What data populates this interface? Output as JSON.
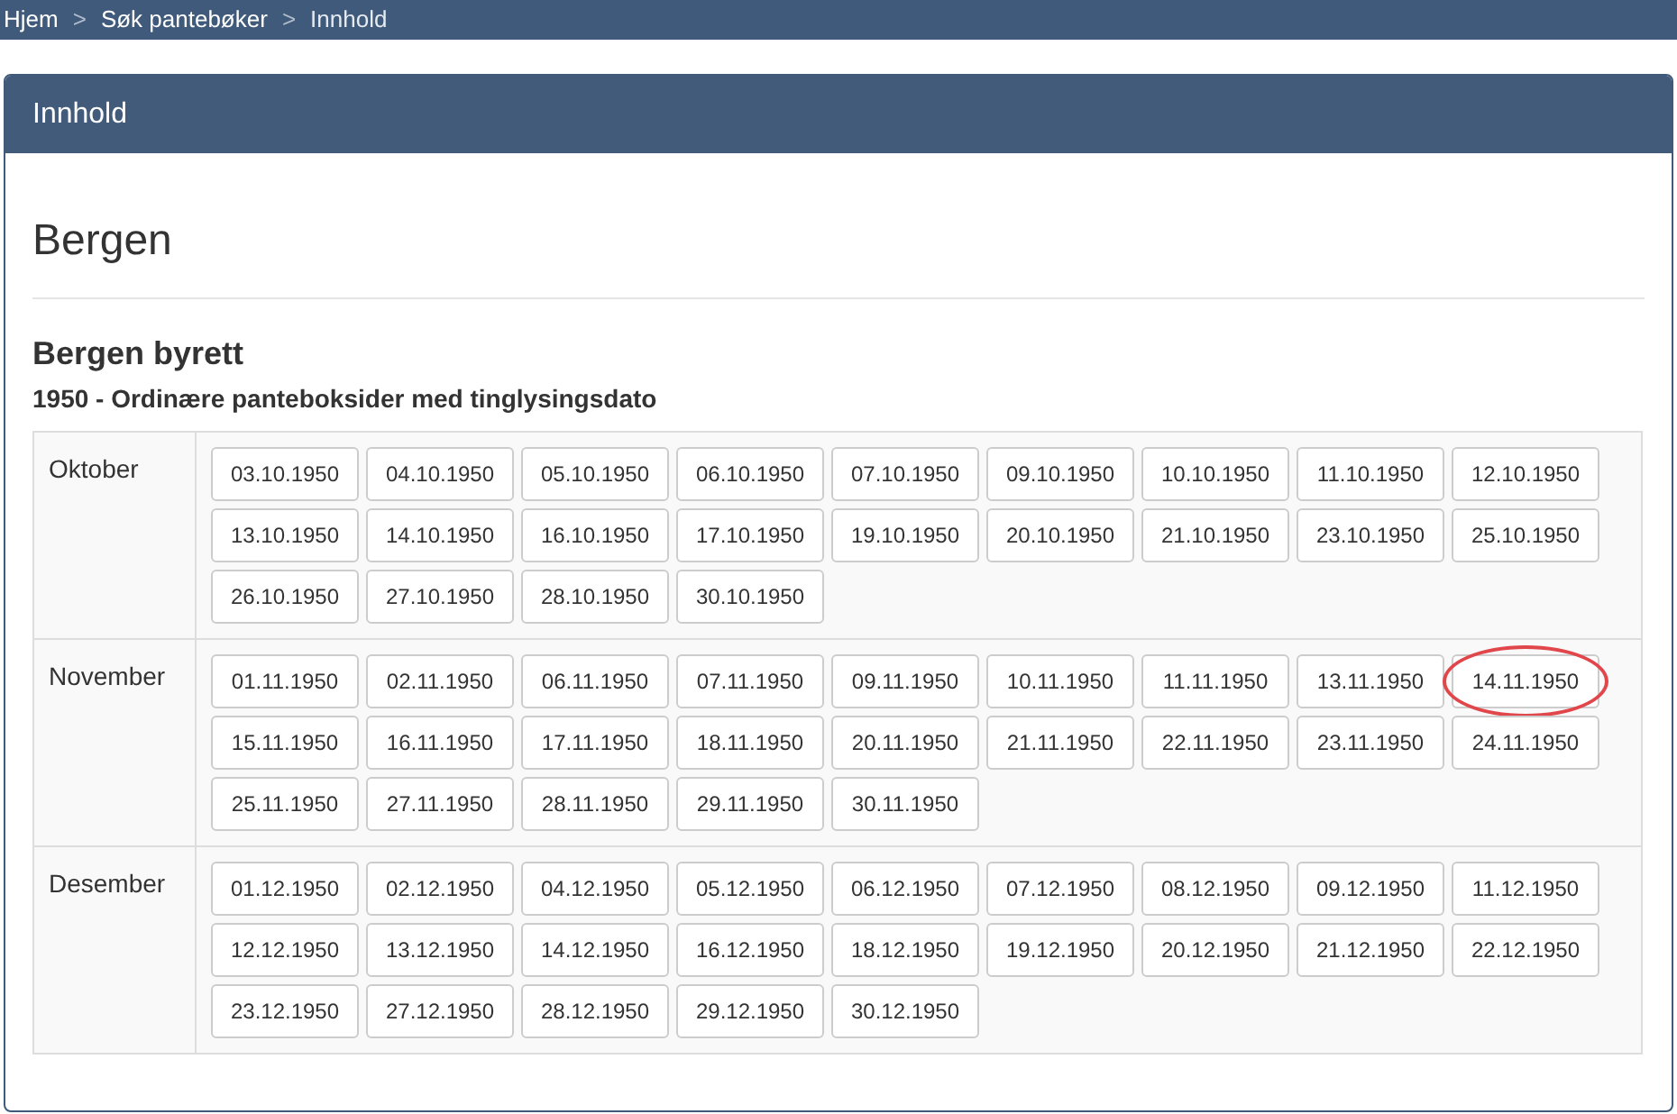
{
  "breadcrumb": [
    "Hjem",
    "Søk pantebøker",
    "Innhold"
  ],
  "breadcrumb_separator": ">",
  "panel": {
    "title": "Innhold"
  },
  "place": "Bergen",
  "court": "Bergen byrett",
  "subtitle": "1950 - Ordinære panteboksider med tinglysingsdato",
  "months": [
    {
      "name": "Oktober",
      "dates": [
        {
          "label": "03.10.1950",
          "circled": false
        },
        {
          "label": "04.10.1950",
          "circled": false
        },
        {
          "label": "05.10.1950",
          "circled": false
        },
        {
          "label": "06.10.1950",
          "circled": false
        },
        {
          "label": "07.10.1950",
          "circled": false
        },
        {
          "label": "09.10.1950",
          "circled": false
        },
        {
          "label": "10.10.1950",
          "circled": false
        },
        {
          "label": "11.10.1950",
          "circled": false
        },
        {
          "label": "12.10.1950",
          "circled": false
        },
        {
          "label": "13.10.1950",
          "circled": false
        },
        {
          "label": "14.10.1950",
          "circled": false
        },
        {
          "label": "16.10.1950",
          "circled": false
        },
        {
          "label": "17.10.1950",
          "circled": false
        },
        {
          "label": "19.10.1950",
          "circled": false
        },
        {
          "label": "20.10.1950",
          "circled": false
        },
        {
          "label": "21.10.1950",
          "circled": false
        },
        {
          "label": "23.10.1950",
          "circled": false
        },
        {
          "label": "25.10.1950",
          "circled": false
        },
        {
          "label": "26.10.1950",
          "circled": false
        },
        {
          "label": "27.10.1950",
          "circled": false
        },
        {
          "label": "28.10.1950",
          "circled": false
        },
        {
          "label": "30.10.1950",
          "circled": false
        }
      ]
    },
    {
      "name": "November",
      "dates": [
        {
          "label": "01.11.1950",
          "circled": false
        },
        {
          "label": "02.11.1950",
          "circled": false
        },
        {
          "label": "06.11.1950",
          "circled": false
        },
        {
          "label": "07.11.1950",
          "circled": false
        },
        {
          "label": "09.11.1950",
          "circled": false
        },
        {
          "label": "10.11.1950",
          "circled": false
        },
        {
          "label": "11.11.1950",
          "circled": false
        },
        {
          "label": "13.11.1950",
          "circled": false
        },
        {
          "label": "14.11.1950",
          "circled": true
        },
        {
          "label": "15.11.1950",
          "circled": false
        },
        {
          "label": "16.11.1950",
          "circled": false
        },
        {
          "label": "17.11.1950",
          "circled": false
        },
        {
          "label": "18.11.1950",
          "circled": false
        },
        {
          "label": "20.11.1950",
          "circled": false
        },
        {
          "label": "21.11.1950",
          "circled": false
        },
        {
          "label": "22.11.1950",
          "circled": false
        },
        {
          "label": "23.11.1950",
          "circled": false
        },
        {
          "label": "24.11.1950",
          "circled": false
        },
        {
          "label": "25.11.1950",
          "circled": false
        },
        {
          "label": "27.11.1950",
          "circled": false
        },
        {
          "label": "28.11.1950",
          "circled": false
        },
        {
          "label": "29.11.1950",
          "circled": false
        },
        {
          "label": "30.11.1950",
          "circled": false
        }
      ]
    },
    {
      "name": "Desember",
      "dates": [
        {
          "label": "01.12.1950",
          "circled": false
        },
        {
          "label": "02.12.1950",
          "circled": false
        },
        {
          "label": "04.12.1950",
          "circled": false
        },
        {
          "label": "05.12.1950",
          "circled": false
        },
        {
          "label": "06.12.1950",
          "circled": false
        },
        {
          "label": "07.12.1950",
          "circled": false
        },
        {
          "label": "08.12.1950",
          "circled": false
        },
        {
          "label": "09.12.1950",
          "circled": false
        },
        {
          "label": "11.12.1950",
          "circled": false
        },
        {
          "label": "12.12.1950",
          "circled": false
        },
        {
          "label": "13.12.1950",
          "circled": false
        },
        {
          "label": "14.12.1950",
          "circled": false
        },
        {
          "label": "16.12.1950",
          "circled": false
        },
        {
          "label": "18.12.1950",
          "circled": false
        },
        {
          "label": "19.12.1950",
          "circled": false
        },
        {
          "label": "20.12.1950",
          "circled": false
        },
        {
          "label": "21.12.1950",
          "circled": false
        },
        {
          "label": "22.12.1950",
          "circled": false
        },
        {
          "label": "23.12.1950",
          "circled": false
        },
        {
          "label": "27.12.1950",
          "circled": false
        },
        {
          "label": "28.12.1950",
          "circled": false
        },
        {
          "label": "29.12.1950",
          "circled": false
        },
        {
          "label": "30.12.1950",
          "circled": false
        }
      ]
    }
  ]
}
